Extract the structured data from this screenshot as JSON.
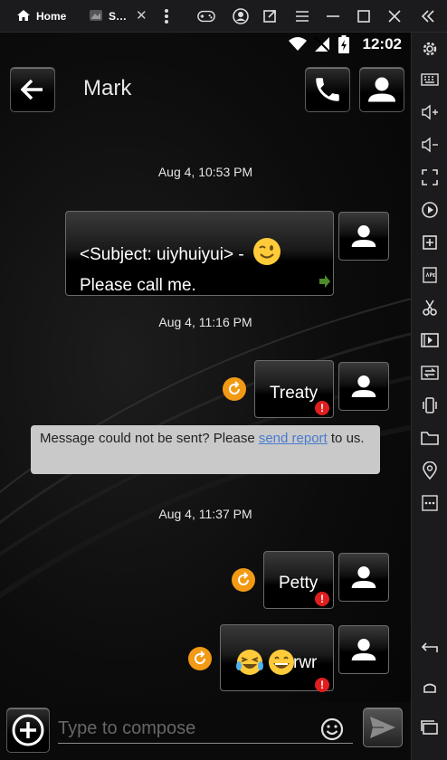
{
  "emulator": {
    "tabs": [
      {
        "label": "Home",
        "icon": "home-icon"
      },
      {
        "label": "S…",
        "icon": "app-thumbnail-icon"
      }
    ],
    "tab_close": "✕",
    "toolbar_icons": [
      "more-vert-icon",
      "gamepad-icon",
      "account-icon",
      "external-link-icon",
      "menu-icon",
      "minimize-icon",
      "maximize-icon",
      "close-icon",
      "collapse-sidebar-icon"
    ],
    "sidebar_icons": [
      "settings-icon",
      "keyboard-icon",
      "volume-up-icon",
      "volume-down-icon",
      "screenshot-resize-icon",
      "record-icon",
      "add-app-icon",
      "apk-icon",
      "cut-icon",
      "media-icon",
      "sync-icon",
      "shake-icon",
      "folder-icon",
      "location-icon",
      "more-horiz-icon",
      "back-icon",
      "home-icon",
      "recents-icon"
    ]
  },
  "status_bar": {
    "time": "12:02"
  },
  "conversation": {
    "contact_name": "Mark",
    "messages": [
      {
        "timestamp": "Aug 4, 10:53 PM",
        "text_line1": "<Subject: uiyhuiyui> -",
        "text_line2": "Please call me.",
        "emoji": "wink"
      },
      {
        "timestamp": "Aug 4, 11:16 PM",
        "text": "Treaty",
        "failed": true
      },
      {
        "timestamp": "Aug 4, 11:37 PM",
        "text": "Petty",
        "failed": true
      },
      {
        "text": "rwr",
        "emoji": "laughing-crying, grinning",
        "failed": true
      }
    ],
    "error_notice": {
      "before": "Message could not be sent? Please ",
      "link": "send report",
      "after": " to us."
    }
  },
  "composer": {
    "placeholder": "Type to compose"
  },
  "colors": {
    "accent_orange": "#f29a15",
    "error_red": "#e01e1e",
    "notice_bg": "#c9c9c9",
    "link_blue": "#4a7bd0"
  }
}
